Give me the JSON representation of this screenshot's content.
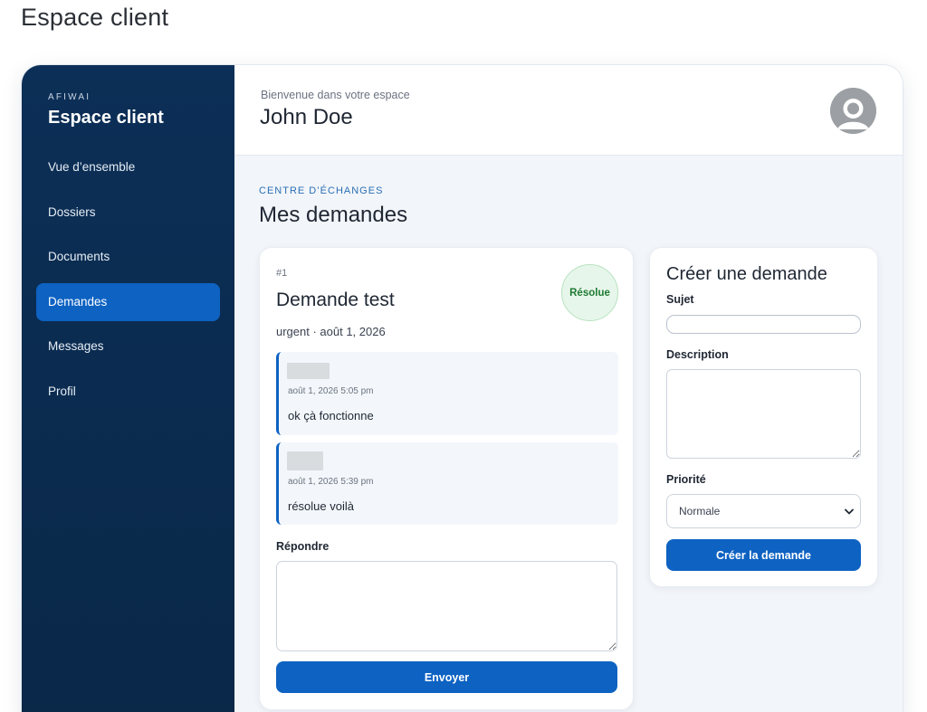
{
  "page": {
    "title": "Espace client"
  },
  "sidebar": {
    "brand_small": "AFIWAI",
    "brand_title": "Espace client",
    "items": [
      {
        "label": "Vue d’ensemble",
        "active": false
      },
      {
        "label": "Dossiers",
        "active": false
      },
      {
        "label": "Documents",
        "active": false
      },
      {
        "label": "Demandes",
        "active": true
      },
      {
        "label": "Messages",
        "active": false
      },
      {
        "label": "Profil",
        "active": false
      }
    ]
  },
  "header": {
    "welcome": "Bienvenue dans votre espace",
    "user_name": "John Doe",
    "avatar_icon": "user-avatar-icon"
  },
  "section": {
    "kicker": "CENTRE D’ÉCHANGES",
    "title": "Mes demandes"
  },
  "request": {
    "number": "#1",
    "title": "Demande test",
    "meta": "urgent · août 1, 2026",
    "status": "Résolue",
    "messages": [
      {
        "time": "août 1, 2026 5:05 pm",
        "text": "ok çà fonctionne"
      },
      {
        "time": "août 1, 2026 5:39 pm",
        "text": "résolue voilà"
      }
    ],
    "reply_label": "Répondre",
    "reply_value": "",
    "send_label": "Envoyer"
  },
  "create": {
    "title": "Créer une demande",
    "subject_label": "Sujet",
    "subject_value": "",
    "description_label": "Description",
    "description_value": "",
    "priority_label": "Priorité",
    "priority_value": "Normale",
    "submit_label": "Créer la demande"
  },
  "colors": {
    "sidebar_bg": "#0b2c52",
    "accent": "#0d62c2",
    "status_green": "#1e7a33"
  }
}
